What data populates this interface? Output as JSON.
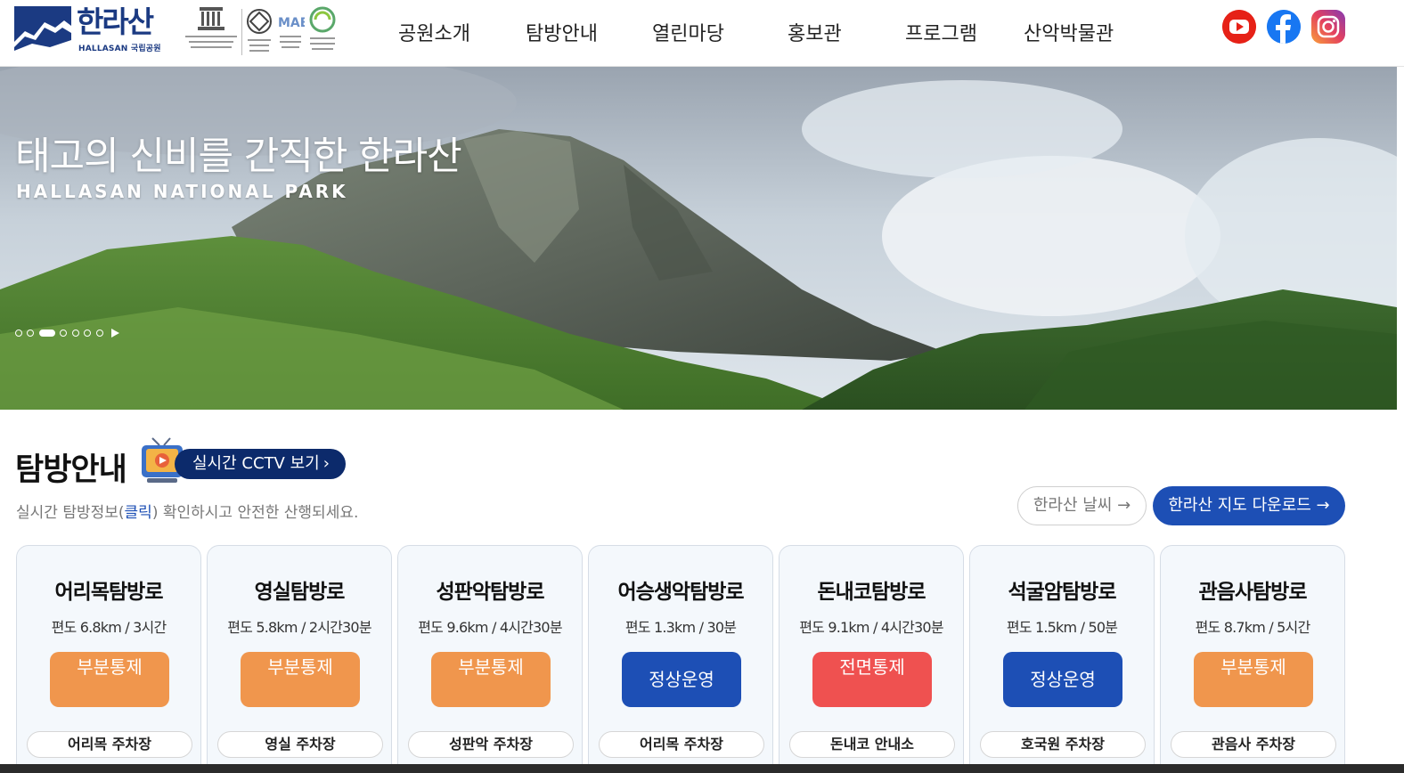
{
  "header": {
    "logo": {
      "hangul": "한라산",
      "subtitle": "HALLASAN 국립공원"
    },
    "certifications": [
      "unesco-heritage-emblem",
      "world-heritage-emblem",
      "biosphere-reserve-emblem",
      "global-geopark-emblem"
    ],
    "nav": [
      "공원소개",
      "탐방안내",
      "열린마당",
      "홍보관",
      "프로그램",
      "산악박물관"
    ],
    "social": [
      "youtube-icon",
      "facebook-icon",
      "instagram-icon"
    ]
  },
  "hero": {
    "title": "태고의 신비를 간직한 한라산",
    "subtitle": "HALLASAN NATIONAL PARK",
    "slide_count": 8,
    "active_slide": 3
  },
  "section": {
    "title": "탐방안내",
    "cctv_label": "실시간 CCTV 보기",
    "desc_before": "실시간 탐방정보(",
    "desc_link": "클릭",
    "desc_after": ") 확인하시고 안전한 산행되세요.",
    "weather_label": "한라산 날씨 →",
    "map_label": "한라산 지도 다운로드 →"
  },
  "trails": [
    {
      "name": "어리목탐방로",
      "info": "편도 6.8km / 3시간",
      "status": "부분통제",
      "status_type": "partial",
      "parking": "어리목 주차장"
    },
    {
      "name": "영실탐방로",
      "info": "편도 5.8km / 2시간30분",
      "status": "부분통제",
      "status_type": "partial",
      "parking": "영실 주차장"
    },
    {
      "name": "성판악탐방로",
      "info": "편도 9.6km / 4시간30분",
      "status": "부분통제",
      "status_type": "partial",
      "parking": "성판악 주차장"
    },
    {
      "name": "어승생악탐방로",
      "info": "편도 1.3km / 30분",
      "status": "정상운영",
      "status_type": "normal",
      "parking": "어리목 주차장"
    },
    {
      "name": "돈내코탐방로",
      "info": "편도 9.1km / 4시간30분",
      "status": "전면통제",
      "status_type": "closed",
      "parking": "돈내코 안내소"
    },
    {
      "name": "석굴암탐방로",
      "info": "편도 1.5km / 50분",
      "status": "정상운영",
      "status_type": "normal",
      "parking": "호국원 주차장"
    },
    {
      "name": "관음사탐방로",
      "info": "편도 8.7km / 5시간",
      "status": "부분통제",
      "status_type": "partial",
      "parking": "관음사 주차장"
    }
  ],
  "colors": {
    "brand_navy": "#1b3a82",
    "cctv_navy": "#0c2a6b",
    "blue": "#1d4fb5",
    "partial": "#f0964d",
    "closed": "#ef5150"
  }
}
